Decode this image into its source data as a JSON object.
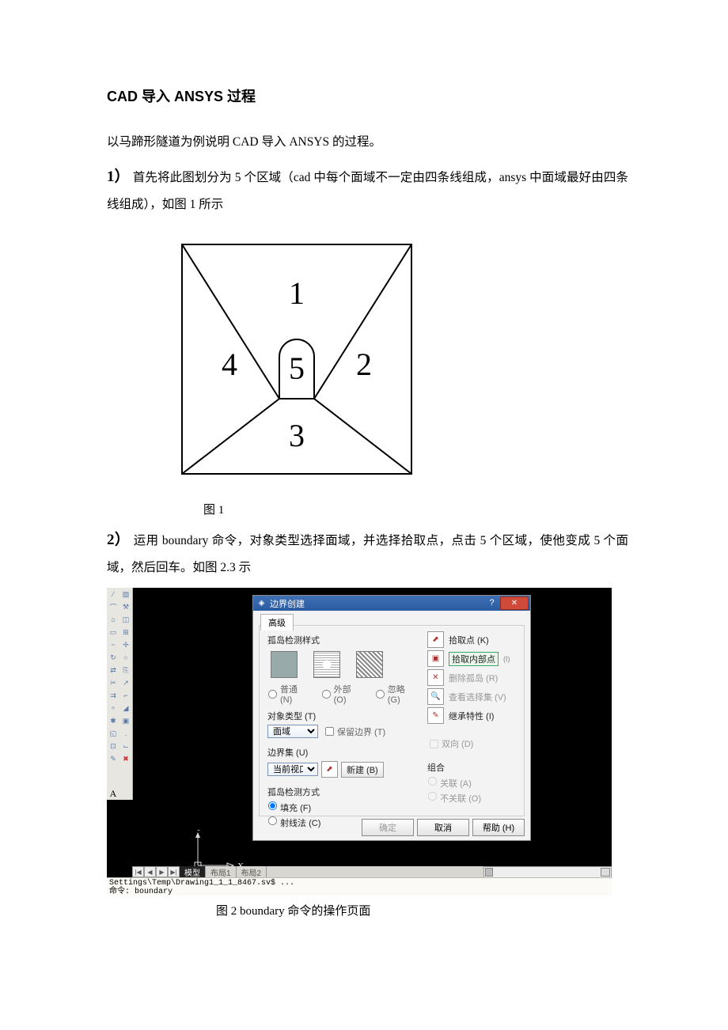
{
  "title": "CAD 导入 ANSYS 过程",
  "intro": "以马蹄形隧道为例说明 CAD 导入 ANSYS 的过程。",
  "step1": {
    "num": "1）",
    "text_a": "首先将此图划分为 5 个区域（cad 中每个面域不一定由四条线组成，ansys 中面域最好由四条线组成），如图 1 所示"
  },
  "fig1": {
    "labels": {
      "r1": "1",
      "r2": "2",
      "r3": "3",
      "r4": "4",
      "r5": "5"
    },
    "caption": "图 1"
  },
  "step2": {
    "num": "2）",
    "text": "运用 boundary 命令，对象类型选择面域，并选择拾取点，点击 5 个区域，使他变成 5 个面域，然后回车。如图 2.3 示"
  },
  "dialog": {
    "title": "边界创建",
    "tab": "高级",
    "island_style": "孤岛检测样式",
    "radios_style": {
      "normal": "普通 (N)",
      "outer": "外部 (O)",
      "ignore": "忽略 (G)"
    },
    "obj_type_label": "对象类型 (T)",
    "obj_type_value": "面域",
    "retain_boundary": "保留边界 (T)",
    "boundary_set_label": "边界集 (U)",
    "boundary_set_value": "当前视口",
    "new_btn": "新建 (B)",
    "detect_method_label": "孤岛检测方式",
    "detect_radios": {
      "fill": "填充 (F)",
      "ray": "射线法 (C)"
    },
    "right": {
      "pick": "拾取点 (K)",
      "pick_inner": "拾取内部点",
      "del_island": "删除孤岛 (R)",
      "view_sel": "查看选择集 (V)",
      "inherit": "继承特性 (I)",
      "dual": "双向 (D)",
      "group_label": "组合",
      "group": {
        "assoc": "关联 (A)",
        "nonassoc": "不关联 (O)"
      }
    },
    "buttons": {
      "ok": "确定",
      "cancel": "取消",
      "help": "帮助 (H)"
    }
  },
  "axis": {
    "x": "X",
    "y": "Y"
  },
  "layout": {
    "nav": [
      "|◀",
      "◀",
      "▶",
      "▶|"
    ],
    "tabs": [
      "模型",
      "布局1",
      "布局2"
    ]
  },
  "cmd": {
    "line1": "Settings\\Temp\\Drawing1_1_1_8467.sv$  ...",
    "line2": "命令: boundary"
  },
  "tool_a": "A",
  "fig2_caption": "图 2 boundary 命令的操作页面"
}
